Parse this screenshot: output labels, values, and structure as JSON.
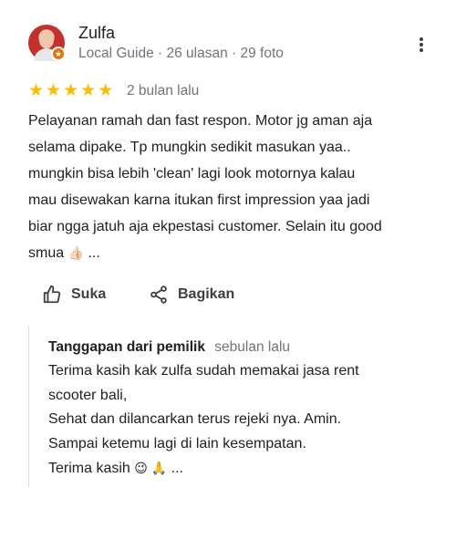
{
  "reviewer": {
    "name": "Zulfa",
    "meta": "Local Guide · 26 ulasan · 29 foto"
  },
  "rating": {
    "stars": 5,
    "time": "2 bulan lalu"
  },
  "review_lines": [
    "Pelayanan ramah dan fast respon. Motor jg aman aja",
    "selama dipake. Tp mungkin sedikit masukan yaa..",
    "mungkin bisa lebih 'clean' lagi look motornya kalau",
    "mau disewakan karna itukan first impression yaa jadi",
    "biar ngga jatuh aja ekpestasi customer. Selain itu good",
    "smua"
  ],
  "review_emoji": "👍🏻",
  "review_more": "...",
  "actions": {
    "like_label": "Suka",
    "share_label": "Bagikan"
  },
  "owner_response": {
    "title": "Tanggapan dari pemilik",
    "time": "sebulan lalu",
    "lines": [
      "Terima kasih kak zulfa sudah memakai jasa rent",
      "scooter bali,",
      "Sehat dan dilancarkan terus rejeki nya. Amin.",
      "Sampai ketemu lagi di lain kesempatan.",
      "Terima kasih"
    ],
    "emoji": "😉 🙏",
    "more": "..."
  },
  "colors": {
    "star": "#fbbc04",
    "badge": "#e8710a",
    "secondary_text": "#70757a"
  },
  "icons": [
    "local-guide-badge-icon",
    "more-vert-icon",
    "star-icon",
    "thumb-up-icon",
    "share-icon"
  ]
}
